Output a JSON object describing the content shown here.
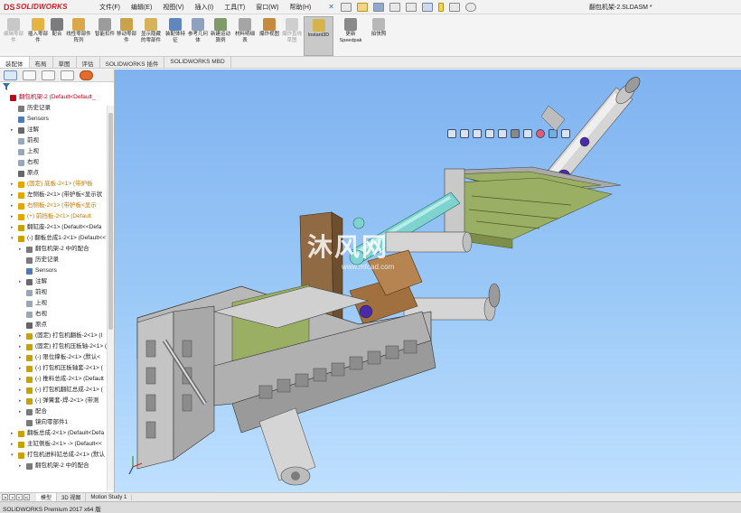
{
  "app": {
    "logo_mark": "DS",
    "logo_text": "SOLIDWORKS",
    "status_text": "SOLIDWORKS Premium 2017 x64 版"
  },
  "menu": [
    "文件(F)",
    "编辑(E)",
    "视图(V)",
    "插入(I)",
    "工具(T)",
    "窗口(W)",
    "帮助(H)"
  ],
  "document": {
    "title": "翻包机架-2.SLDASM *"
  },
  "toolbar": {
    "buttons": [
      {
        "label": "编辑零部件",
        "disabled": true
      },
      {
        "label": "插入零部件",
        "disabled": false
      },
      {
        "label": "配合",
        "disabled": false
      },
      {
        "label": "线性零部件阵列",
        "disabled": false
      },
      {
        "label": "智能扣件",
        "disabled": false
      },
      {
        "label": "移动零部件",
        "disabled": false
      },
      {
        "label": "显示隐藏的零部件",
        "disabled": false
      },
      {
        "label": "装配体特征",
        "disabled": false
      },
      {
        "label": "参考几何体",
        "disabled": false
      },
      {
        "label": "新建运动算例",
        "disabled": false
      },
      {
        "label": "材料明细表",
        "disabled": false
      },
      {
        "label": "爆炸视图",
        "disabled": false
      },
      {
        "label": "爆炸直线草图",
        "disabled": true
      },
      {
        "label": "Instant3D",
        "disabled": false,
        "active": true
      },
      {
        "label": "更新Speedpak",
        "disabled": false
      },
      {
        "label": "拍快照",
        "disabled": false
      }
    ]
  },
  "cmd_tabs": [
    {
      "label": "装配体",
      "active": true
    },
    {
      "label": "布局",
      "active": false
    },
    {
      "label": "草图",
      "active": false
    },
    {
      "label": "评估",
      "active": false
    },
    {
      "label": "SOLIDWORKS 插件",
      "active": false
    },
    {
      "label": "SOLIDWORKS MBD",
      "active": false
    }
  ],
  "tree": [
    {
      "label": "翻包机架-2  (Default<Default_",
      "indent": 0,
      "arrow": "",
      "icon": "#c0001c",
      "style": "red"
    },
    {
      "label": "历史记录",
      "indent": 1,
      "arrow": "",
      "icon": "#7a7a7a",
      "style": ""
    },
    {
      "label": "Sensors",
      "indent": 1,
      "arrow": "",
      "icon": "#4f7bb3",
      "style": ""
    },
    {
      "label": "注解",
      "indent": 1,
      "arrow": "▸",
      "icon": "#6a6a6a",
      "style": ""
    },
    {
      "label": "前视",
      "indent": 1,
      "arrow": "",
      "icon": "#9aa7b6",
      "style": ""
    },
    {
      "label": "上视",
      "indent": 1,
      "arrow": "",
      "icon": "#9aa7b6",
      "style": ""
    },
    {
      "label": "右视",
      "indent": 1,
      "arrow": "",
      "icon": "#9aa7b6",
      "style": ""
    },
    {
      "label": "原点",
      "indent": 1,
      "arrow": "",
      "icon": "#666666",
      "style": ""
    },
    {
      "label": "(固定) 底板-2<1> (带护板",
      "indent": 1,
      "arrow": "▸",
      "icon": "#e0a800",
      "style": "warn"
    },
    {
      "label": "左侧板-2<1> (带护板<显示状",
      "indent": 1,
      "arrow": "▸",
      "icon": "#e0a800",
      "style": ""
    },
    {
      "label": "右侧板-2<1> (带护板<显示",
      "indent": 1,
      "arrow": "▸",
      "icon": "#e0a800",
      "style": "warn"
    },
    {
      "label": "(+) 前挡板-2<1> (Default",
      "indent": 1,
      "arrow": "▸",
      "icon": "#e0a800",
      "style": "warn"
    },
    {
      "label": "翻缸座-2<1> (Default<<Defa",
      "indent": 1,
      "arrow": "▸",
      "icon": "#c8a200",
      "style": ""
    },
    {
      "label": "(-) 翻板总成1-2<1> (Default<<",
      "indent": 1,
      "arrow": "▾",
      "icon": "#c8a200",
      "style": ""
    },
    {
      "label": "翻包机架-2 中的配合",
      "indent": 2,
      "arrow": "▸",
      "icon": "#7a7a7a",
      "style": ""
    },
    {
      "label": "历史记录",
      "indent": 2,
      "arrow": "",
      "icon": "#7a7a7a",
      "style": ""
    },
    {
      "label": "Sensors",
      "indent": 2,
      "arrow": "",
      "icon": "#4f7bb3",
      "style": ""
    },
    {
      "label": "注解",
      "indent": 2,
      "arrow": "▸",
      "icon": "#6a6a6a",
      "style": ""
    },
    {
      "label": "前视",
      "indent": 2,
      "arrow": "",
      "icon": "#9aa7b6",
      "style": ""
    },
    {
      "label": "上视",
      "indent": 2,
      "arrow": "",
      "icon": "#9aa7b6",
      "style": ""
    },
    {
      "label": "右视",
      "indent": 2,
      "arrow": "",
      "icon": "#9aa7b6",
      "style": ""
    },
    {
      "label": "原点",
      "indent": 2,
      "arrow": "",
      "icon": "#666666",
      "style": ""
    },
    {
      "label": "(固定) 打包机翻板-2<1> (I",
      "indent": 2,
      "arrow": "▸",
      "icon": "#c8a200",
      "style": ""
    },
    {
      "label": "(固定) 打包机压板轴-2<1> (",
      "indent": 2,
      "arrow": "▸",
      "icon": "#c8a200",
      "style": ""
    },
    {
      "label": "(-) 限位撑板-2<1> (默认<",
      "indent": 2,
      "arrow": "▸",
      "icon": "#c8a200",
      "style": ""
    },
    {
      "label": "(-) 打包机压板轴套-2<1> (",
      "indent": 2,
      "arrow": "▸",
      "icon": "#c8a200",
      "style": ""
    },
    {
      "label": "(-) 推料总成-2<1> (Default",
      "indent": 2,
      "arrow": "▸",
      "icon": "#c8a200",
      "style": ""
    },
    {
      "label": "(-) 打包机翻缸总成-2<1> (",
      "indent": 2,
      "arrow": "▸",
      "icon": "#c8a200",
      "style": ""
    },
    {
      "label": "(-) 弹簧套-焊-2<1> (带测",
      "indent": 2,
      "arrow": "▸",
      "icon": "#c8a200",
      "style": ""
    },
    {
      "label": "配合",
      "indent": 2,
      "arrow": "▸",
      "icon": "#7a7a7a",
      "style": ""
    },
    {
      "label": "镜向零部件1",
      "indent": 2,
      "arrow": "",
      "icon": "#7a7a7a",
      "style": ""
    },
    {
      "label": "翻板总成-2<1> (Default<Defa",
      "indent": 1,
      "arrow": "▸",
      "icon": "#c8a200",
      "style": ""
    },
    {
      "label": "主缸侧板-2<1> -> (Default<<",
      "indent": 1,
      "arrow": "▸",
      "icon": "#c8a200",
      "style": ""
    },
    {
      "label": "打包机进料缸总成-2<1> (默认",
      "indent": 1,
      "arrow": "▾",
      "icon": "#c8a200",
      "style": ""
    },
    {
      "label": "翻包机架-2 中的配合",
      "indent": 2,
      "arrow": "▸",
      "icon": "#7a7a7a",
      "style": ""
    }
  ],
  "viewport": {
    "watermark": "沐风网",
    "watermark_url": "www.mfcad.com",
    "hud_icons": [
      "zoom-fit-icon",
      "zoom-area-icon",
      "previous-view-icon",
      "section-view-icon",
      "view-orientation-icon",
      "display-style-icon",
      "hide-show-icon",
      "edit-appearance-icon",
      "scene-icon",
      "view-settings-icon"
    ]
  },
  "bottom_tabs": [
    {
      "label": "模型",
      "active": true
    },
    {
      "label": "3D 视图",
      "active": false
    },
    {
      "label": "Motion Study 1",
      "active": false
    }
  ],
  "colors": {
    "frame": "#b8b8b8",
    "frame_dark": "#8c8c8c",
    "plate_green": "#9aae64",
    "cylinder": "#d5d5d5",
    "cyan_rod": "#7fd3cf",
    "bronze": "#a0713e",
    "brown_plate": "#8f6a42",
    "purple_fitting": "#4a2aa8",
    "viewport_top": "#7fb2f0",
    "viewport_bottom": "#bfe0ff"
  }
}
